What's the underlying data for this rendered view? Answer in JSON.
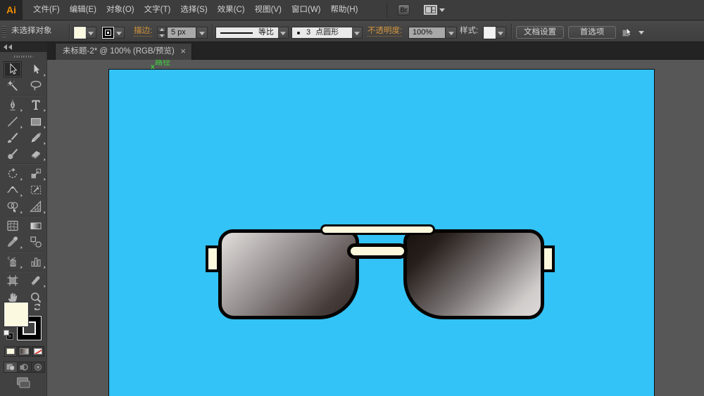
{
  "app": {
    "logo": "Ai",
    "bridge_button": "Br",
    "workspace_icon": "workspace-switcher-icon"
  },
  "menubar": {
    "items": [
      {
        "label": "文件(F)"
      },
      {
        "label": "编辑(E)"
      },
      {
        "label": "对象(O)"
      },
      {
        "label": "文字(T)"
      },
      {
        "label": "选择(S)"
      },
      {
        "label": "效果(C)"
      },
      {
        "label": "视图(V)"
      },
      {
        "label": "窗口(W)"
      },
      {
        "label": "帮助(H)"
      }
    ]
  },
  "controlbar": {
    "status": "未选择对象",
    "stroke_label": "描边:",
    "stroke_width": "5 px",
    "profile": "等比",
    "brush_size": "3",
    "brush_name": "点圆形",
    "opacity_label": "不透明度:",
    "opacity_value": "100%",
    "style_label": "样式:",
    "doc_setup_button": "文档设置",
    "preferences_button": "首选项"
  },
  "tabbar": {
    "title": "未标题-2* @ 100% (RGB/预览)",
    "close": "×"
  },
  "toolbar": {
    "groups": [
      [
        {
          "name": "selection-tool",
          "icon": "ic-selection",
          "active": true,
          "flyout": false
        },
        {
          "name": "direct-selection-tool",
          "icon": "ic-direct-selection",
          "flyout": true
        },
        {
          "name": "magic-wand-tool",
          "icon": "ic-magic-wand",
          "flyout": false
        },
        {
          "name": "lasso-tool",
          "icon": "ic-lasso",
          "flyout": false
        }
      ],
      [
        {
          "name": "pen-tool",
          "icon": "ic-pen",
          "flyout": true
        },
        {
          "name": "type-tool",
          "icon": "ic-type",
          "flyout": true
        },
        {
          "name": "line-segment-tool",
          "icon": "ic-line",
          "flyout": true
        },
        {
          "name": "rectangle-tool",
          "icon": "ic-rectangle",
          "flyout": true
        },
        {
          "name": "paintbrush-tool",
          "icon": "ic-paintbrush",
          "flyout": false
        },
        {
          "name": "pencil-tool",
          "icon": "ic-pencil",
          "flyout": true
        },
        {
          "name": "blob-brush-tool",
          "icon": "ic-blob-brush",
          "flyout": false
        },
        {
          "name": "eraser-tool",
          "icon": "ic-eraser",
          "flyout": true
        }
      ],
      [
        {
          "name": "rotate-tool",
          "icon": "ic-rotate",
          "flyout": true
        },
        {
          "name": "scale-tool",
          "icon": "ic-scale",
          "flyout": true
        },
        {
          "name": "width-tool",
          "icon": "ic-width",
          "flyout": true
        },
        {
          "name": "free-transform-tool",
          "icon": "ic-free-transform",
          "flyout": false
        },
        {
          "name": "shape-builder-tool",
          "icon": "ic-shape-builder",
          "flyout": true
        },
        {
          "name": "perspective-grid-tool",
          "icon": "ic-perspective-grid",
          "flyout": true
        }
      ],
      [
        {
          "name": "mesh-tool",
          "icon": "ic-mesh",
          "flyout": false
        },
        {
          "name": "gradient-tool",
          "icon": "ic-gradient",
          "flyout": false
        },
        {
          "name": "eyedropper-tool",
          "icon": "ic-eyedropper",
          "flyout": true
        },
        {
          "name": "blend-tool",
          "icon": "ic-blend",
          "flyout": false
        }
      ],
      [
        {
          "name": "symbol-sprayer-tool",
          "icon": "ic-symbol-sprayer",
          "flyout": true
        },
        {
          "name": "column-graph-tool",
          "icon": "ic-column-graph",
          "flyout": true
        }
      ],
      [
        {
          "name": "artboard-tool",
          "icon": "ic-artboard",
          "flyout": false
        },
        {
          "name": "slice-tool",
          "icon": "ic-slice",
          "flyout": true
        },
        {
          "name": "hand-tool",
          "icon": "ic-hand",
          "flyout": false
        },
        {
          "name": "zoom-tool",
          "icon": "ic-zoom",
          "flyout": false
        }
      ]
    ]
  },
  "canvas": {
    "smart_guide_label": "路径",
    "smart_guide_mark": "x",
    "colors": {
      "artboard_background": "#33c3f7",
      "pasteboard": "#575757",
      "glasses_cream": "#fbf8dc",
      "glasses_outline": "#060401",
      "lens_left_gradient": [
        "#dad7d5",
        "#453b38"
      ],
      "lens_right_gradient": [
        "#1e1813",
        "#cbc8c7"
      ],
      "smart_guide_green": "#3fd13c"
    },
    "zoom_percent": "100%"
  }
}
